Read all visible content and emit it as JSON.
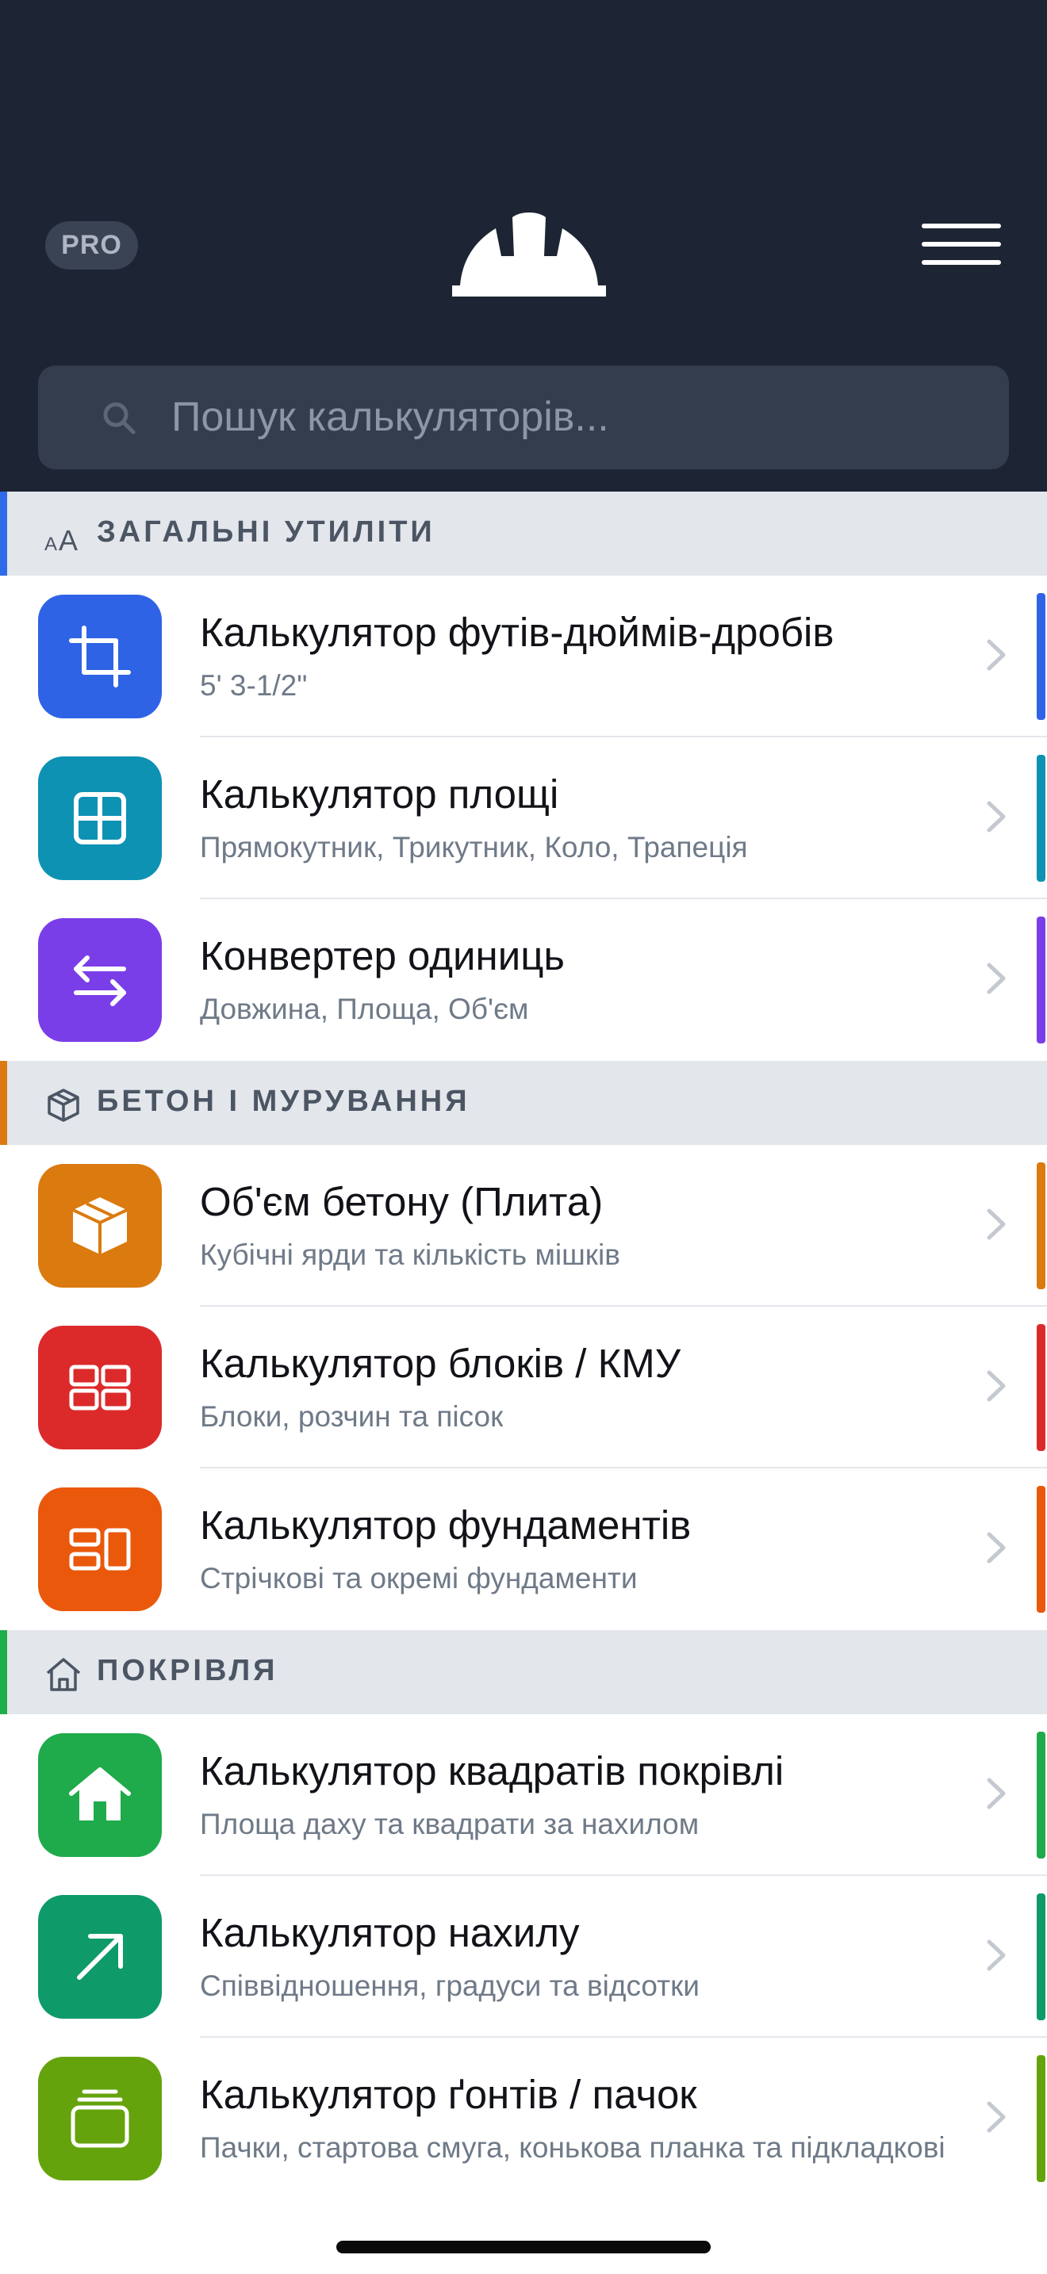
{
  "header": {
    "pro_label": "PRO",
    "logo_icon": "hard-hat-icon",
    "menu_icon": "hamburger-menu-icon"
  },
  "search": {
    "placeholder": "Пошук калькуляторів...",
    "value": "",
    "icon": "search-icon"
  },
  "sections": [
    {
      "title": "ЗАГАЛЬНІ УТИЛІТИ",
      "icon": "text-size-icon",
      "accent": "#2f6ae8",
      "items": [
        {
          "title": "Калькулятор футів-дюймів-дробів",
          "subtitle": "5' 3-1/2\"",
          "icon": "crop-icon",
          "color": "#2f63e6"
        },
        {
          "title": "Калькулятор площі",
          "subtitle": "Прямокутник, Трикутник, Коло, Трапеція",
          "icon": "grid-square-icon",
          "color": "#0e92b4"
        },
        {
          "title": "Конвертер одиниць",
          "subtitle": "Довжина, Площа, Об'єм",
          "icon": "swap-arrows-icon",
          "color": "#7a3ee8"
        }
      ]
    },
    {
      "title": "БЕТОН І МУРУВАННЯ",
      "icon": "cube-outline-icon",
      "accent": "#dc7a12",
      "items": [
        {
          "title": "Об'єм бетону (Плита)",
          "subtitle": "Кубічні ярди та кількість мішків",
          "icon": "box-icon",
          "color": "#db7a0f"
        },
        {
          "title": "Калькулятор блоків / КМУ",
          "subtitle": "Блоки, розчин та пісок",
          "icon": "blocks-icon",
          "color": "#dc2a2a"
        },
        {
          "title": "Калькулятор фундаментів",
          "subtitle": "Стрічкові та окремі фундаменти",
          "icon": "footing-icon",
          "color": "#ea580c"
        }
      ]
    },
    {
      "title": "ПОКРІВЛЯ",
      "icon": "house-outline-icon",
      "accent": "#1fae4c",
      "items": [
        {
          "title": "Калькулятор квадратів покрівлі",
          "subtitle": "Площа даху та квадрати за нахилом",
          "icon": "house-icon",
          "color": "#1fab4b"
        },
        {
          "title": "Калькулятор нахилу",
          "subtitle": "Співвідношення, градуси та відсотки",
          "icon": "arrow-up-right-icon",
          "color": "#0e9a69"
        },
        {
          "title": "Калькулятор ґонтів / пачок",
          "subtitle": "Пачки, стартова смуга, конькова планка та підкладкові",
          "icon": "layers-icon",
          "color": "#65a30d"
        }
      ]
    }
  ]
}
